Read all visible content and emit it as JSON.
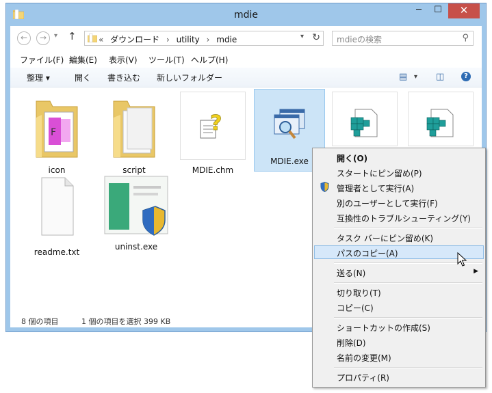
{
  "window": {
    "title": "mdie"
  },
  "window_controls": {
    "minimize": "─",
    "maximize": "☐",
    "close": "✕"
  },
  "nav": {
    "back": "←",
    "forward": "→",
    "up": "↑"
  },
  "address": {
    "chevron": "«",
    "crumbs": [
      "ダウンロード",
      "utility",
      "mdie"
    ],
    "separator": "›"
  },
  "search": {
    "placeholder": "mdieの検索"
  },
  "menubar": [
    "ファイル(F)",
    "編集(E)",
    "表示(V)",
    "ツール(T)",
    "ヘルプ(H)"
  ],
  "commandbar": {
    "organize": "整理 ▾",
    "open": "開く",
    "burn": "書き込む",
    "new_folder": "新しいフォルダー"
  },
  "files": [
    {
      "name": "icon",
      "type": "folder"
    },
    {
      "name": "script",
      "type": "folder"
    },
    {
      "name": "MDIE.chm",
      "type": "chm"
    },
    {
      "name": "MDIE.exe",
      "type": "exe",
      "selected": true
    },
    {
      "name": "",
      "type": "manifest"
    },
    {
      "name": "",
      "type": "manifest"
    },
    {
      "name": "readme.txt",
      "type": "txt"
    },
    {
      "name": "uninst.exe",
      "type": "installer"
    }
  ],
  "status": {
    "count": "8 個の項目",
    "selection": "1 個の項目を選択  399 KB"
  },
  "context_menu": {
    "open": "開く(O)",
    "pin_start": "スタートにピン留め(P)",
    "run_admin": "管理者として実行(A)",
    "run_other_user": "別のユーザーとして実行(F)",
    "troubleshoot": "互換性のトラブルシューティング(Y)",
    "pin_taskbar": "タスク バーにピン留め(K)",
    "copy_path": "パスのコピー(A)",
    "send_to": "送る(N)",
    "cut": "切り取り(T)",
    "copy": "コピー(C)",
    "create_shortcut": "ショートカットの作成(S)",
    "delete": "削除(D)",
    "rename": "名前の変更(M)",
    "properties": "プロパティ(R)"
  },
  "colors": {
    "titlebar": "#9fc7ea",
    "close": "#c7504a",
    "selection": "#cce4f7",
    "menu_highlight": "#d6e8fa"
  }
}
